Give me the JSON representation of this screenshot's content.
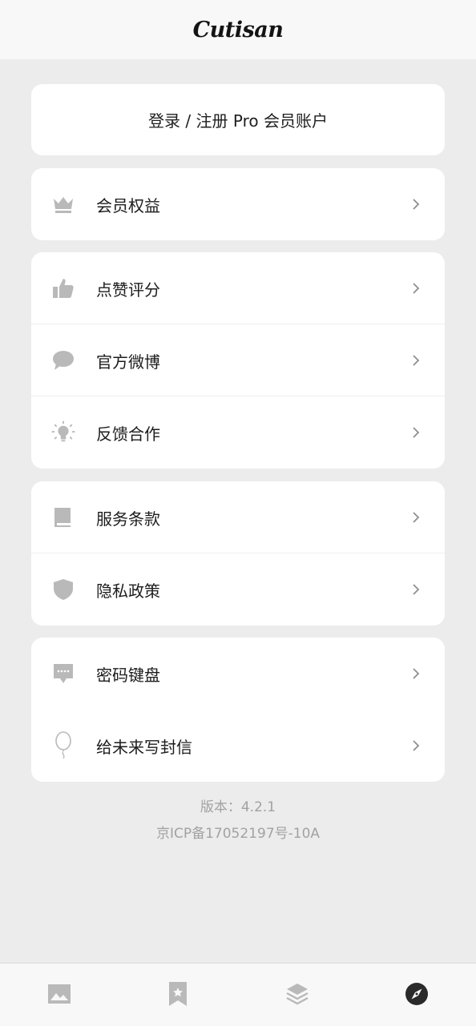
{
  "header": {
    "logo": "Cutisan"
  },
  "login": {
    "label": "登录 / 注册 Pro 会员账户"
  },
  "groups": [
    {
      "items": [
        {
          "label": "会员权益",
          "icon": "crown-icon"
        }
      ]
    },
    {
      "items": [
        {
          "label": "点赞评分",
          "icon": "thumbs-up-icon"
        },
        {
          "label": "官方微博",
          "icon": "chat-bubble-icon"
        },
        {
          "label": "反馈合作",
          "icon": "lightbulb-icon"
        }
      ]
    },
    {
      "items": [
        {
          "label": "服务条款",
          "icon": "book-icon"
        },
        {
          "label": "隐私政策",
          "icon": "shield-icon"
        }
      ]
    },
    {
      "items": [
        {
          "label": "密码键盘",
          "icon": "message-dots-icon"
        },
        {
          "label": "给未来写封信",
          "icon": "balloon-icon"
        }
      ]
    }
  ],
  "footer": {
    "version": "版本：4.2.1",
    "icp": "京ICP备17052197号-10A"
  },
  "tabbar": {
    "tabs": [
      {
        "icon": "image-icon",
        "active": false
      },
      {
        "icon": "bookmark-star-icon",
        "active": false
      },
      {
        "icon": "layers-icon",
        "active": false
      },
      {
        "icon": "compass-icon",
        "active": true
      }
    ]
  },
  "colors": {
    "background": "#ececec",
    "card": "#ffffff",
    "icon_gray": "#b9b9b9",
    "chevron": "#8e8e8e",
    "active_tab": "#2a2a2a",
    "footer_text": "#a2a2a2"
  }
}
